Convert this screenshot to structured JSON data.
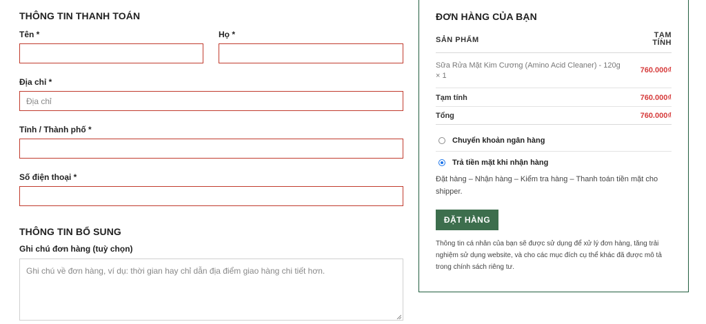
{
  "billing": {
    "title": "THÔNG TIN THANH TOÁN",
    "first_name_label": "Tên *",
    "last_name_label": "Họ *",
    "address_label": "Địa chỉ *",
    "address_placeholder": "Địa chỉ",
    "city_label": "Tỉnh / Thành phố *",
    "phone_label": "Số điện thoại *"
  },
  "additional": {
    "title": "THÔNG TIN BỔ SUNG",
    "notes_label": "Ghi chú đơn hàng (tuỳ chọn)",
    "notes_placeholder": "Ghi chú về đơn hàng, ví dụ: thời gian hay chỉ dẫn địa điểm giao hàng chi tiết hơn."
  },
  "order": {
    "title": "ĐƠN HÀNG CỦA BẠN",
    "col_product": "SẢN PHẨM",
    "col_subtotal_line1": "TẠM",
    "col_subtotal_line2": "TÍNH",
    "item_name": "Sữa Rửa Mặt Kim Cương (Amino Acid Cleaner) - 120g",
    "item_qty": "× 1",
    "item_price": "760.000₫",
    "subtotal_label": "Tạm tính",
    "subtotal_value": "760.000₫",
    "total_label": "Tổng",
    "total_value": "760.000₫",
    "payment_bank_label": "Chuyển khoản ngân hàng",
    "payment_cod_label": "Trả tiền mặt khi nhận hàng",
    "payment_cod_desc": "Đặt hàng – Nhận hàng – Kiểm tra hàng – Thanh toán tiền mặt cho shipper.",
    "place_order_label": "ĐẶT HÀNG",
    "privacy_text": "Thông tin cá nhân của bạn sẽ được sử dụng để xử lý đơn hàng, tăng trải nghiệm sử dụng website, và cho các mục đích cụ thể khác đã được mô tả trong chính sách riêng tư."
  },
  "colors": {
    "field_border": "#c0392b",
    "order_border": "#1f5c3d",
    "button_bg": "#3d6e4d",
    "price": "#d63b3b"
  }
}
